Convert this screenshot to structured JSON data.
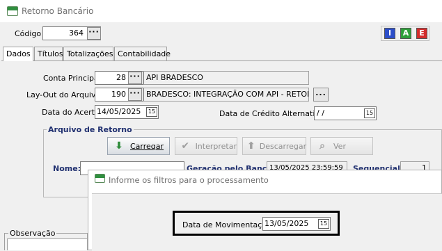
{
  "window": {
    "title": "Retorno Bancário"
  },
  "header": {
    "codigo_label": "Código",
    "codigo_value": "364",
    "icon_i": "I",
    "icon_a": "A",
    "icon_e": "E"
  },
  "tabs": [
    {
      "label": "Dados",
      "active": true
    },
    {
      "label": "Títulos"
    },
    {
      "label": "Totalizações"
    },
    {
      "label": "Contabilidade"
    }
  ],
  "form": {
    "conta_label": "Conta Principal",
    "conta_code": "28",
    "conta_desc": "API BRADESCO",
    "layout_label": "Lay-Out do Arquivo",
    "layout_code": "190",
    "layout_desc": "BRADESCO: INTEGRAÇÃO COM API - RETORNO",
    "data_acerto_label": "Data do Acerto",
    "data_acerto_value": "14/05/2025",
    "data_credito_label": "Data de Crédito Alternativa",
    "data_credito_value": " / /"
  },
  "arquivo": {
    "group_title": "Arquivo de Retorno",
    "btn_carregar": "Carregar",
    "btn_interpretar": "Interpretar",
    "btn_descarregar": "Descarregar",
    "btn_ver": "Ver",
    "nome_label": "Nome:",
    "geracao_label": "Geração pelo Banco:",
    "geracao_value": "13/05/2025 23:59:59",
    "sequencial_label": "Sequencial:",
    "sequencial_value": "1"
  },
  "observacao_label": "Observação",
  "dialog": {
    "title": "Informe os filtros para o processamento",
    "data_mov_label": "Data de Movimentação",
    "data_mov_value": "13/05/2025"
  },
  "colors": {
    "group_title": "#1f2f6f",
    "icon_i": "#2c4ec9",
    "icon_a": "#2e9e3a",
    "icon_e": "#d42c2c"
  }
}
